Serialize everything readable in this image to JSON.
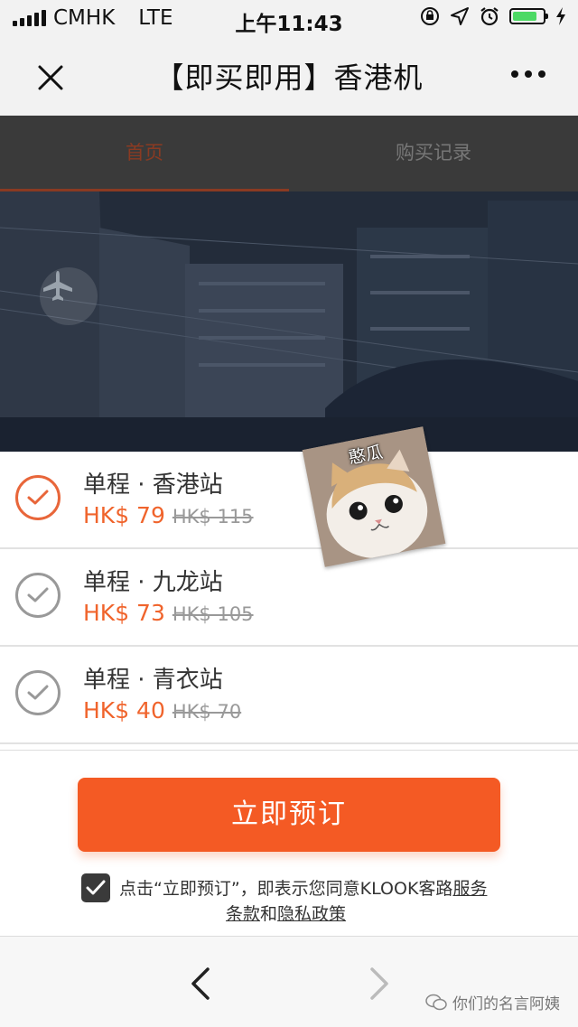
{
  "status_bar": {
    "carrier": "CMHK",
    "network": "LTE",
    "time": "上午11:43"
  },
  "nav": {
    "title": "【即买即用】香港机"
  },
  "tabs": [
    {
      "label": "首页"
    },
    {
      "label": "购买记录"
    }
  ],
  "options": [
    {
      "name": "单程 · 香港站",
      "price": "HK$ 79",
      "original_price": "HK$ 115",
      "selected": true
    },
    {
      "name": "单程 · 九龙站",
      "price": "HK$ 73",
      "original_price": "HK$ 105",
      "selected": false
    },
    {
      "name": "单程 · 青衣站",
      "price": "HK$ 40",
      "original_price": "HK$ 70",
      "selected": false
    }
  ],
  "sticker": {
    "label": "憨瓜"
  },
  "book": {
    "button_label": "立即预订",
    "agree_prefix": "点击“立即预订”，即表示您同意KLOOK客路",
    "terms_link_1": "服务",
    "terms_link_2": "条款",
    "and": "和",
    "privacy_link": "隐私政策"
  },
  "watermark": {
    "text": "你们的名言阿姨"
  },
  "colors": {
    "accent": "#f45a24",
    "price": "#f0642c",
    "tab_bar": "#3a3a3a",
    "battery": "#4cd964"
  }
}
